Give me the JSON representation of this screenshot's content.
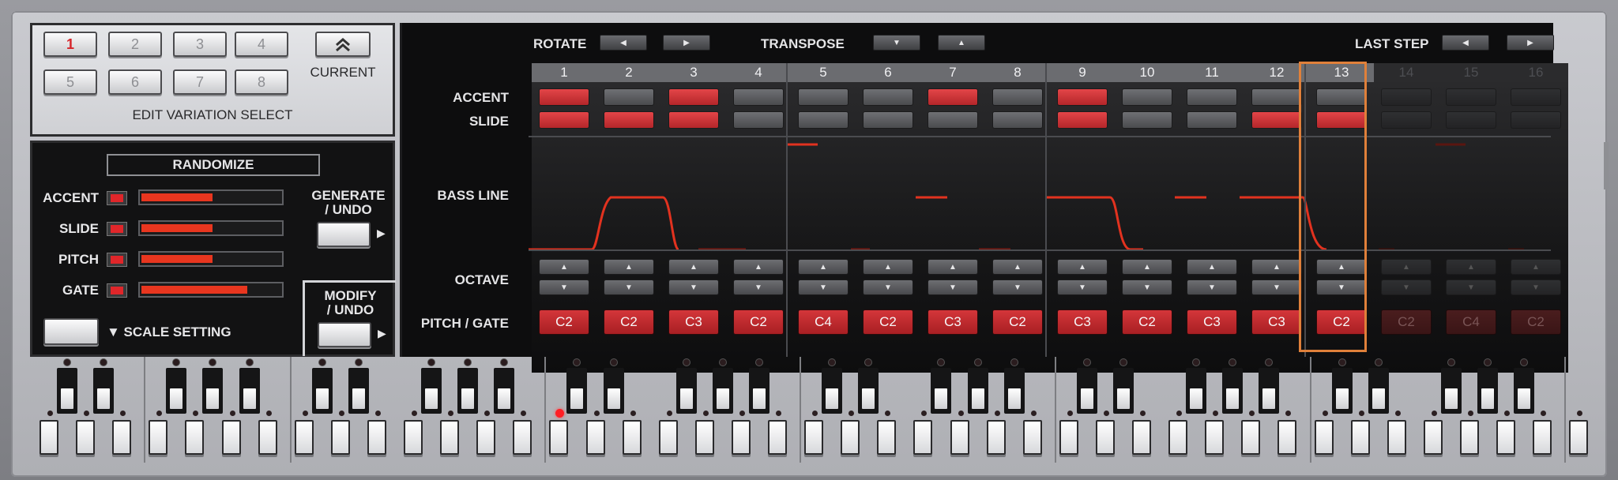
{
  "variation": {
    "buttons": [
      "1",
      "2",
      "3",
      "4",
      "5",
      "6",
      "7",
      "8"
    ],
    "selected": "1",
    "caption": "EDIT VARIATION SELECT",
    "current_label": "CURRENT",
    "current_icon": "double-chevron-up-icon"
  },
  "randomize": {
    "title": "RANDOMIZE",
    "rows": [
      {
        "label": "ACCENT",
        "enabled": true,
        "amount": 0.51
      },
      {
        "label": "SLIDE",
        "enabled": true,
        "amount": 0.51
      },
      {
        "label": "PITCH",
        "enabled": true,
        "amount": 0.51
      },
      {
        "label": "GATE",
        "enabled": true,
        "amount": 0.76
      }
    ],
    "generate_label": "GENERATE / UNDO",
    "modify_label": "MODIFY / UNDO",
    "scale_label": "▼ SCALE SETTING"
  },
  "sequencer": {
    "rotate_label": "ROTATE",
    "transpose_label": "TRANSPOSE",
    "last_step_label": "LAST STEP",
    "row_labels": {
      "accent": "ACCENT",
      "slide": "SLIDE",
      "bass_line": "BASS LINE",
      "octave": "OCTAVE",
      "pitch_gate": "PITCH / GATE"
    },
    "last_step": 13,
    "accent_color": "#d8353a",
    "cursor_color": "#e0803a",
    "steps": [
      {
        "n": "1",
        "accent": true,
        "slide": true,
        "note": "C2"
      },
      {
        "n": "2",
        "accent": false,
        "slide": true,
        "note": "C2"
      },
      {
        "n": "3",
        "accent": true,
        "slide": true,
        "note": "C3"
      },
      {
        "n": "4",
        "accent": false,
        "slide": false,
        "note": "C2"
      },
      {
        "n": "5",
        "accent": false,
        "slide": false,
        "note": "C4"
      },
      {
        "n": "6",
        "accent": false,
        "slide": false,
        "note": "C2"
      },
      {
        "n": "7",
        "accent": true,
        "slide": false,
        "note": "C3"
      },
      {
        "n": "8",
        "accent": false,
        "slide": false,
        "note": "C2"
      },
      {
        "n": "9",
        "accent": true,
        "slide": true,
        "note": "C3"
      },
      {
        "n": "10",
        "accent": false,
        "slide": false,
        "note": "C2"
      },
      {
        "n": "11",
        "accent": false,
        "slide": false,
        "note": "C3"
      },
      {
        "n": "12",
        "accent": false,
        "slide": true,
        "note": "C3"
      },
      {
        "n": "13",
        "accent": false,
        "slide": true,
        "note": "C2"
      },
      {
        "n": "14",
        "accent": false,
        "slide": false,
        "note": "C2"
      },
      {
        "n": "15",
        "accent": false,
        "slide": false,
        "note": "C4"
      },
      {
        "n": "16",
        "accent": false,
        "slide": false,
        "note": "C2"
      }
    ]
  },
  "keyboard": {
    "active_key_index": 14
  }
}
